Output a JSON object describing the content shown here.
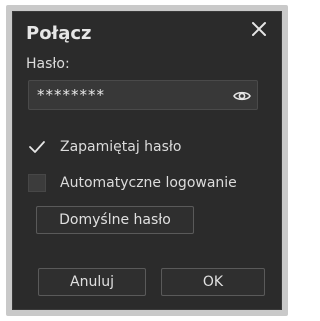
{
  "dialog": {
    "title": "Połącz",
    "password_label": "Hasło:",
    "password_value": "********",
    "remember_password": {
      "label": "Zapamiętaj hasło",
      "checked": true
    },
    "auto_login": {
      "label": "Automatyczne logowanie",
      "checked": false
    },
    "default_password_button": "Domyślne hasło",
    "cancel_button": "Anuluj",
    "ok_button": "OK"
  },
  "icons": {
    "close": "close-icon",
    "eye": "eye-icon",
    "check": "checkmark-icon"
  },
  "colors": {
    "dialog_background": "#2b2b2b",
    "field_background": "#383838",
    "text": "#e6e6e6",
    "frame": "#c9c9c9"
  }
}
